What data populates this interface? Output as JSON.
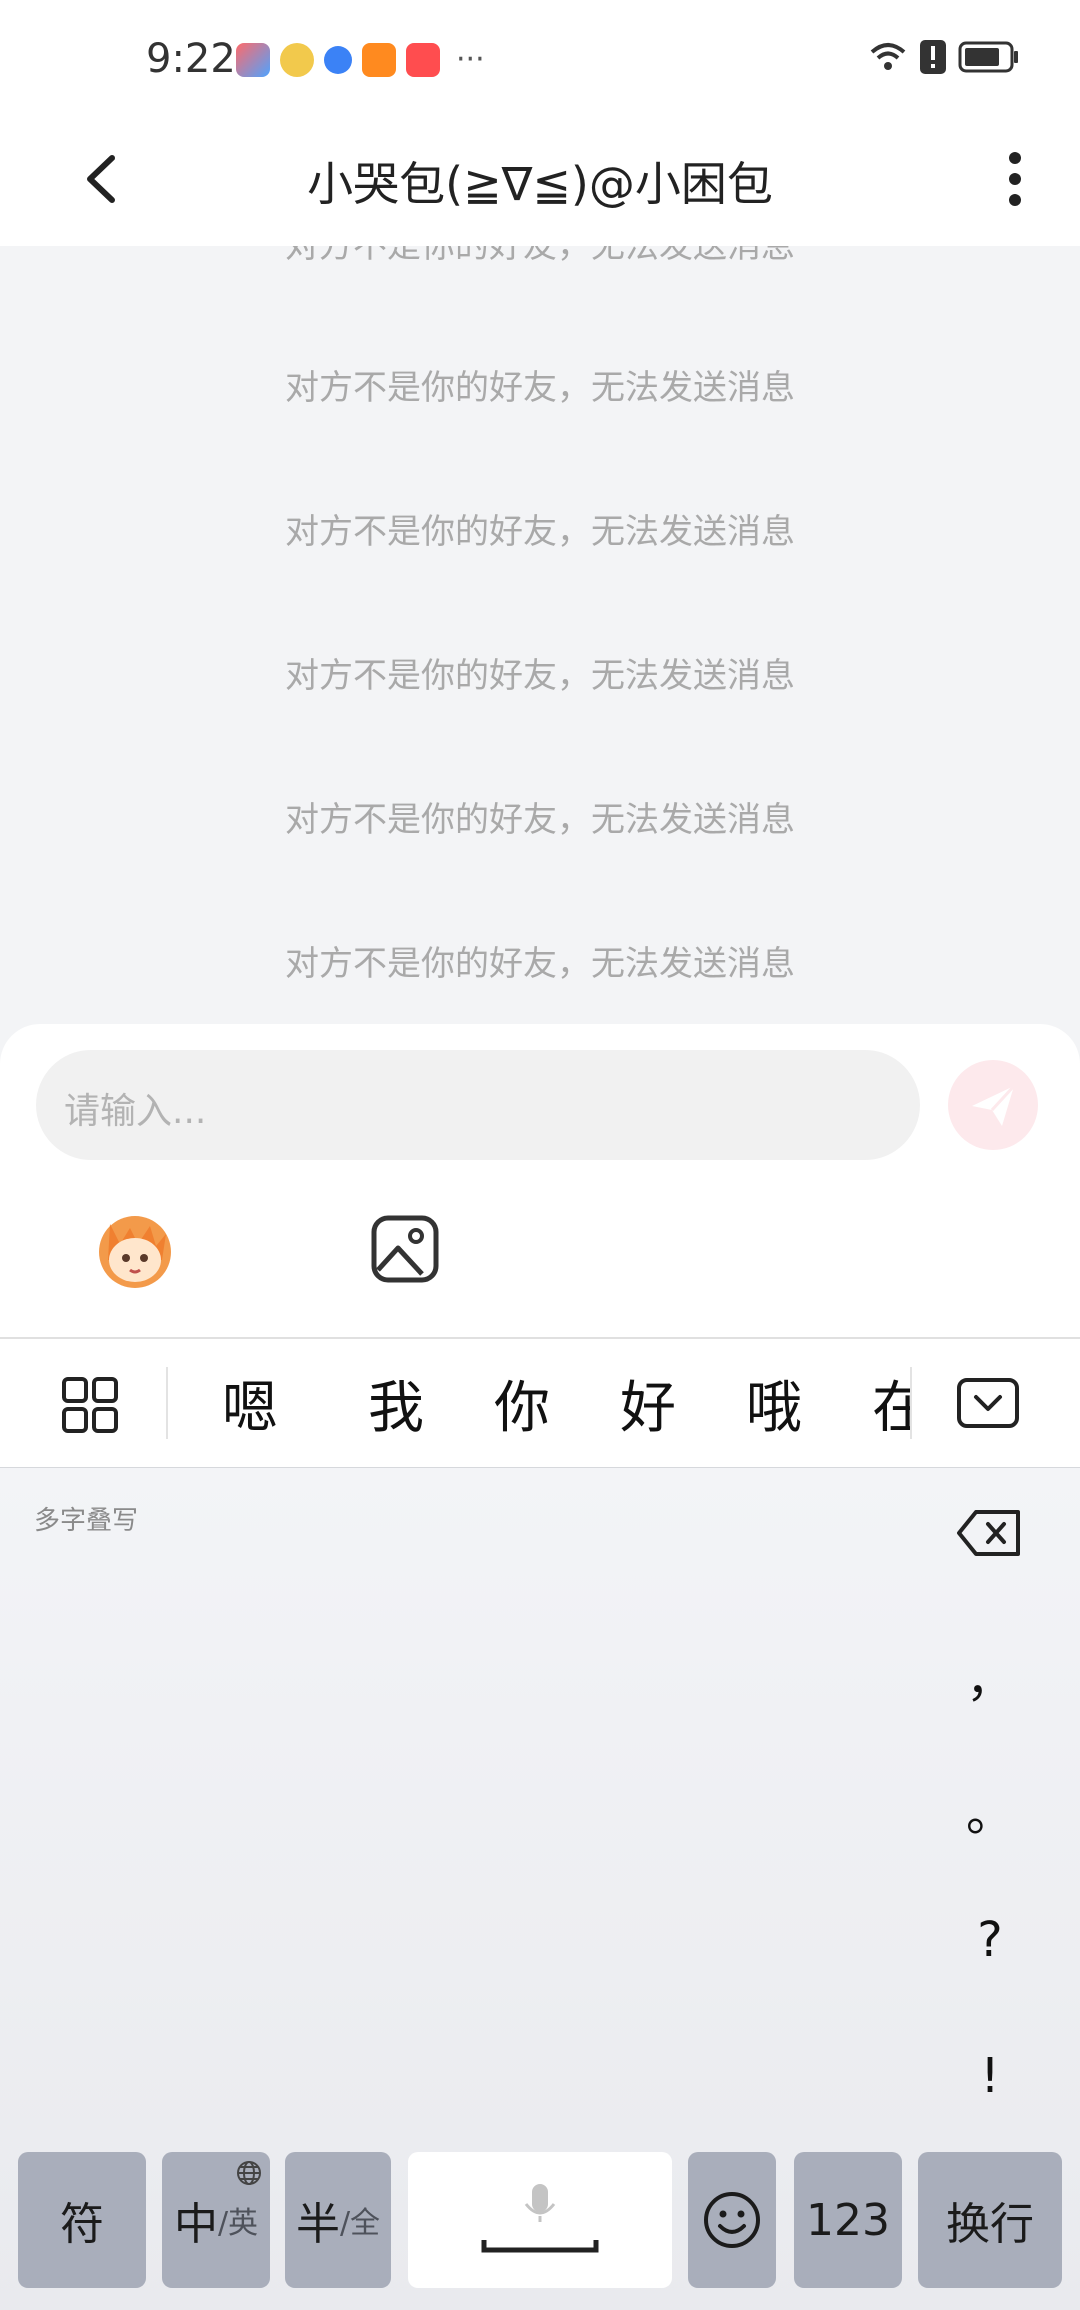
{
  "status_bar": {
    "time": "9:22",
    "more": "···"
  },
  "header": {
    "title": "小哭包(≧∇≦)@小困包"
  },
  "messages": [
    "对方不是你的好友，无法发送消息",
    "对方不是你的好友，无法发送消息",
    "对方不是你的好友，无法发送消息",
    "对方不是你的好友，无法发送消息",
    "对方不是你的好友，无法发送消息",
    "对方不是你的好友，无法发送消息"
  ],
  "composer": {
    "placeholder": "请输入..."
  },
  "candidates": [
    "嗯",
    "我",
    "你",
    "好",
    "哦",
    "在"
  ],
  "keyboard": {
    "handwriting_label": "多字叠写",
    "punctuation": [
      "，",
      "。",
      "?",
      "!"
    ],
    "keys": {
      "symbol": "符",
      "zh": "中",
      "en": "/英",
      "half": "半",
      "full": "/全",
      "num": "123",
      "enter": "换行"
    }
  },
  "colors": {
    "accent": "#f7a8b5",
    "msg_text": "#a9a9a9",
    "key_gray": "#a9aebb"
  }
}
